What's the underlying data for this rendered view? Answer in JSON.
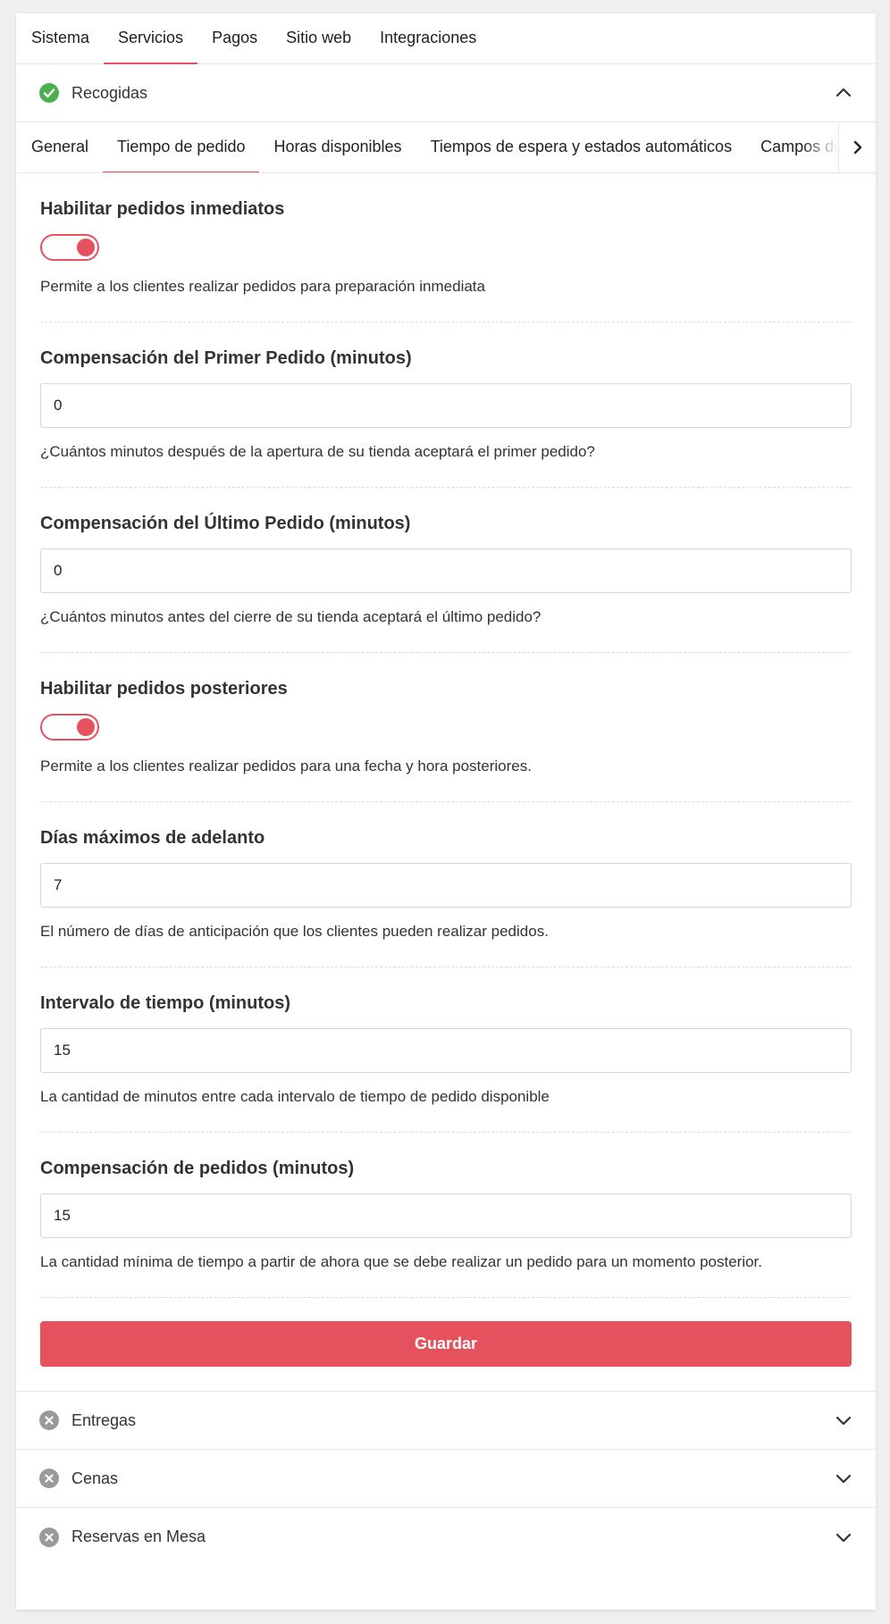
{
  "top_tabs": [
    "Sistema",
    "Servicios",
    "Pagos",
    "Sitio web",
    "Integraciones"
  ],
  "accordion_open": {
    "title": "Recogidas",
    "status_icon": "check-circle-icon"
  },
  "sub_tabs": [
    "General",
    "Tiempo de pedido",
    "Horas disponibles",
    "Tiempos de espera y estados automáticos",
    "Campos de"
  ],
  "form": {
    "immediate": {
      "label": "Habilitar pedidos inmediatos",
      "enabled": true,
      "help": "Permite a los clientes realizar pedidos para preparación inmediata"
    },
    "first_offset": {
      "label": "Compensación del Primer Pedido (minutos)",
      "value": "0",
      "help": "¿Cuántos minutos después de la apertura de su tienda aceptará el primer pedido?"
    },
    "last_offset": {
      "label": "Compensación del Último Pedido (minutos)",
      "value": "0",
      "help": "¿Cuántos minutos antes del cierre de su tienda aceptará el último pedido?"
    },
    "later": {
      "label": "Habilitar pedidos posteriores",
      "enabled": true,
      "help": "Permite a los clientes realizar pedidos para una fecha y hora posteriores."
    },
    "max_days": {
      "label": "Días máximos de adelanto",
      "value": "7",
      "help": "El número de días de anticipación que los clientes pueden realizar pedidos."
    },
    "interval": {
      "label": "Intervalo de tiempo (minutos)",
      "value": "15",
      "help": "La cantidad de minutos entre cada intervalo de tiempo de pedido disponible"
    },
    "order_offset": {
      "label": "Compensación de pedidos (minutos)",
      "value": "15",
      "help": "La cantidad mínima de tiempo a partir de ahora que se debe realizar un pedido para un momento posterior."
    },
    "save_label": "Guardar"
  },
  "accordions_closed": [
    {
      "title": "Entregas",
      "status_icon": "x-circle-icon"
    },
    {
      "title": "Cenas",
      "status_icon": "x-circle-icon"
    },
    {
      "title": "Reservas en Mesa",
      "status_icon": "x-circle-icon"
    }
  ],
  "colors": {
    "accent": "#e5525e",
    "success": "#4caf50",
    "disabled": "#9a9a9a"
  }
}
